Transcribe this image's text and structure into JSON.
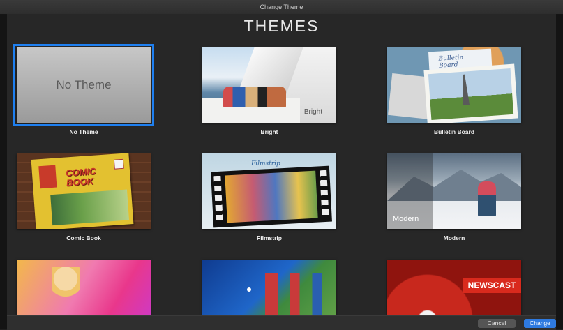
{
  "window": {
    "title": "Change Theme"
  },
  "sheet": {
    "heading": "THEMES"
  },
  "themes": [
    {
      "name": "No Theme",
      "thumb_text": "No Theme",
      "selected": true
    },
    {
      "name": "Bright",
      "thumb_text": "Bright"
    },
    {
      "name": "Bulletin Board",
      "thumb_text": "Bulletin\nBoard"
    },
    {
      "name": "Comic Book",
      "thumb_text": "COMIC\nBOOK"
    },
    {
      "name": "Filmstrip",
      "thumb_text": "Filmstrip"
    },
    {
      "name": "Modern",
      "thumb_text": "Modern"
    },
    {
      "name": "",
      "thumb_text": ""
    },
    {
      "name": "",
      "thumb_text": ""
    },
    {
      "name": "",
      "thumb_text": "NEWSCAST"
    }
  ],
  "buttons": {
    "cancel": "Cancel",
    "change": "Change"
  },
  "colors": {
    "accent": "#2e7ae0",
    "selection": "#1e7ff0"
  }
}
